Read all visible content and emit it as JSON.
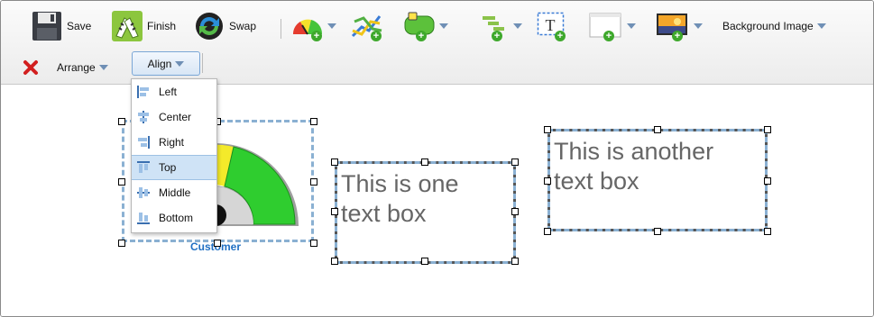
{
  "toolbar": {
    "save_label": "Save",
    "finish_label": "Finish",
    "swap_label": "Swap",
    "background_image_label": "Background Image",
    "arrange_label": "Arrange",
    "align_label": "Align"
  },
  "align_menu": {
    "items": [
      {
        "label": "Left",
        "icon": "align-left-icon"
      },
      {
        "label": "Center",
        "icon": "align-center-icon"
      },
      {
        "label": "Right",
        "icon": "align-right-icon"
      },
      {
        "label": "Top",
        "icon": "align-top-icon",
        "selected": true
      },
      {
        "label": "Middle",
        "icon": "align-middle-icon"
      },
      {
        "label": "Bottom",
        "icon": "align-bottom-icon"
      }
    ]
  },
  "canvas": {
    "gauge_caption": "Customer",
    "text_box_1": "This is one\ntext box",
    "text_box_2": "This is another\ntext box"
  },
  "colors": {
    "accent_blue": "#1f6fc3",
    "selection_dash": "#8ab0d2",
    "menu_highlight": "#cfe3f6",
    "delete_red": "#d21f1f",
    "plus_green": "#3ea82c"
  }
}
